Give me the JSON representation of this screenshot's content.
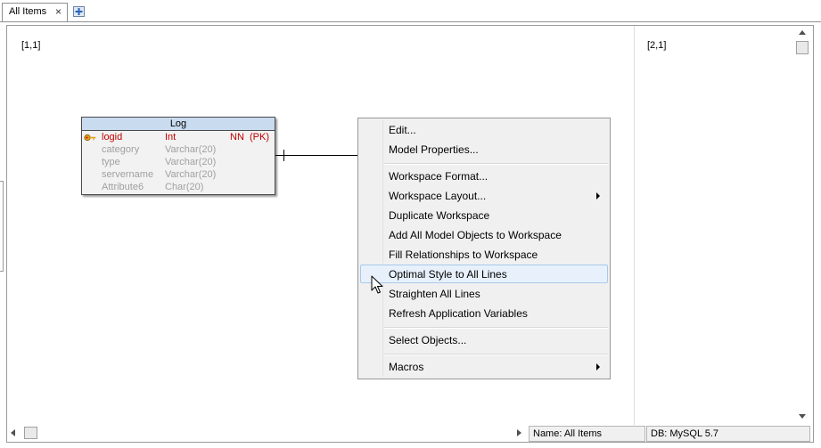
{
  "tabs": {
    "active_label": "All Items",
    "close_glyph": "×",
    "add_icon": "new-tab-icon"
  },
  "canvas": {
    "page_1_label": "[1,1]",
    "page_2_label": "[2,1]"
  },
  "entity": {
    "title": "Log",
    "pk_icon": "key-icon",
    "attributes": [
      {
        "name": "logid",
        "type": "Int",
        "nn": "NN",
        "pk": "(PK)"
      },
      {
        "name": "category",
        "type": "Varchar(20)",
        "nn": "",
        "pk": ""
      },
      {
        "name": "type",
        "type": "Varchar(20)",
        "nn": "",
        "pk": ""
      },
      {
        "name": "servername",
        "type": "Varchar(20)",
        "nn": "",
        "pk": ""
      },
      {
        "name": "Attribute6",
        "type": "Char(20)",
        "nn": "",
        "pk": ""
      }
    ]
  },
  "context_menu": {
    "items": [
      {
        "label": "Edit..."
      },
      {
        "label": "Model Properties..."
      },
      {
        "label": "Workspace Format..."
      },
      {
        "label": "Workspace Layout...",
        "submenu": true
      },
      {
        "label": "Duplicate Workspace"
      },
      {
        "label": "Add All Model Objects to Workspace"
      },
      {
        "label": "Fill Relationships to Workspace"
      },
      {
        "label": "Optimal Style to All Lines",
        "highlighted": true
      },
      {
        "label": "Straighten All Lines"
      },
      {
        "label": "Refresh Application Variables"
      },
      {
        "label": "Select Objects..."
      },
      {
        "label": "Macros",
        "submenu": true
      }
    ]
  },
  "status_bar": {
    "name": "Name: All Items",
    "db": "DB: MySQL 5.7"
  },
  "colors": {
    "entity_header": "#c9dbef",
    "primary_key": "#c00000",
    "menu_highlight": "#e8f1fb"
  }
}
